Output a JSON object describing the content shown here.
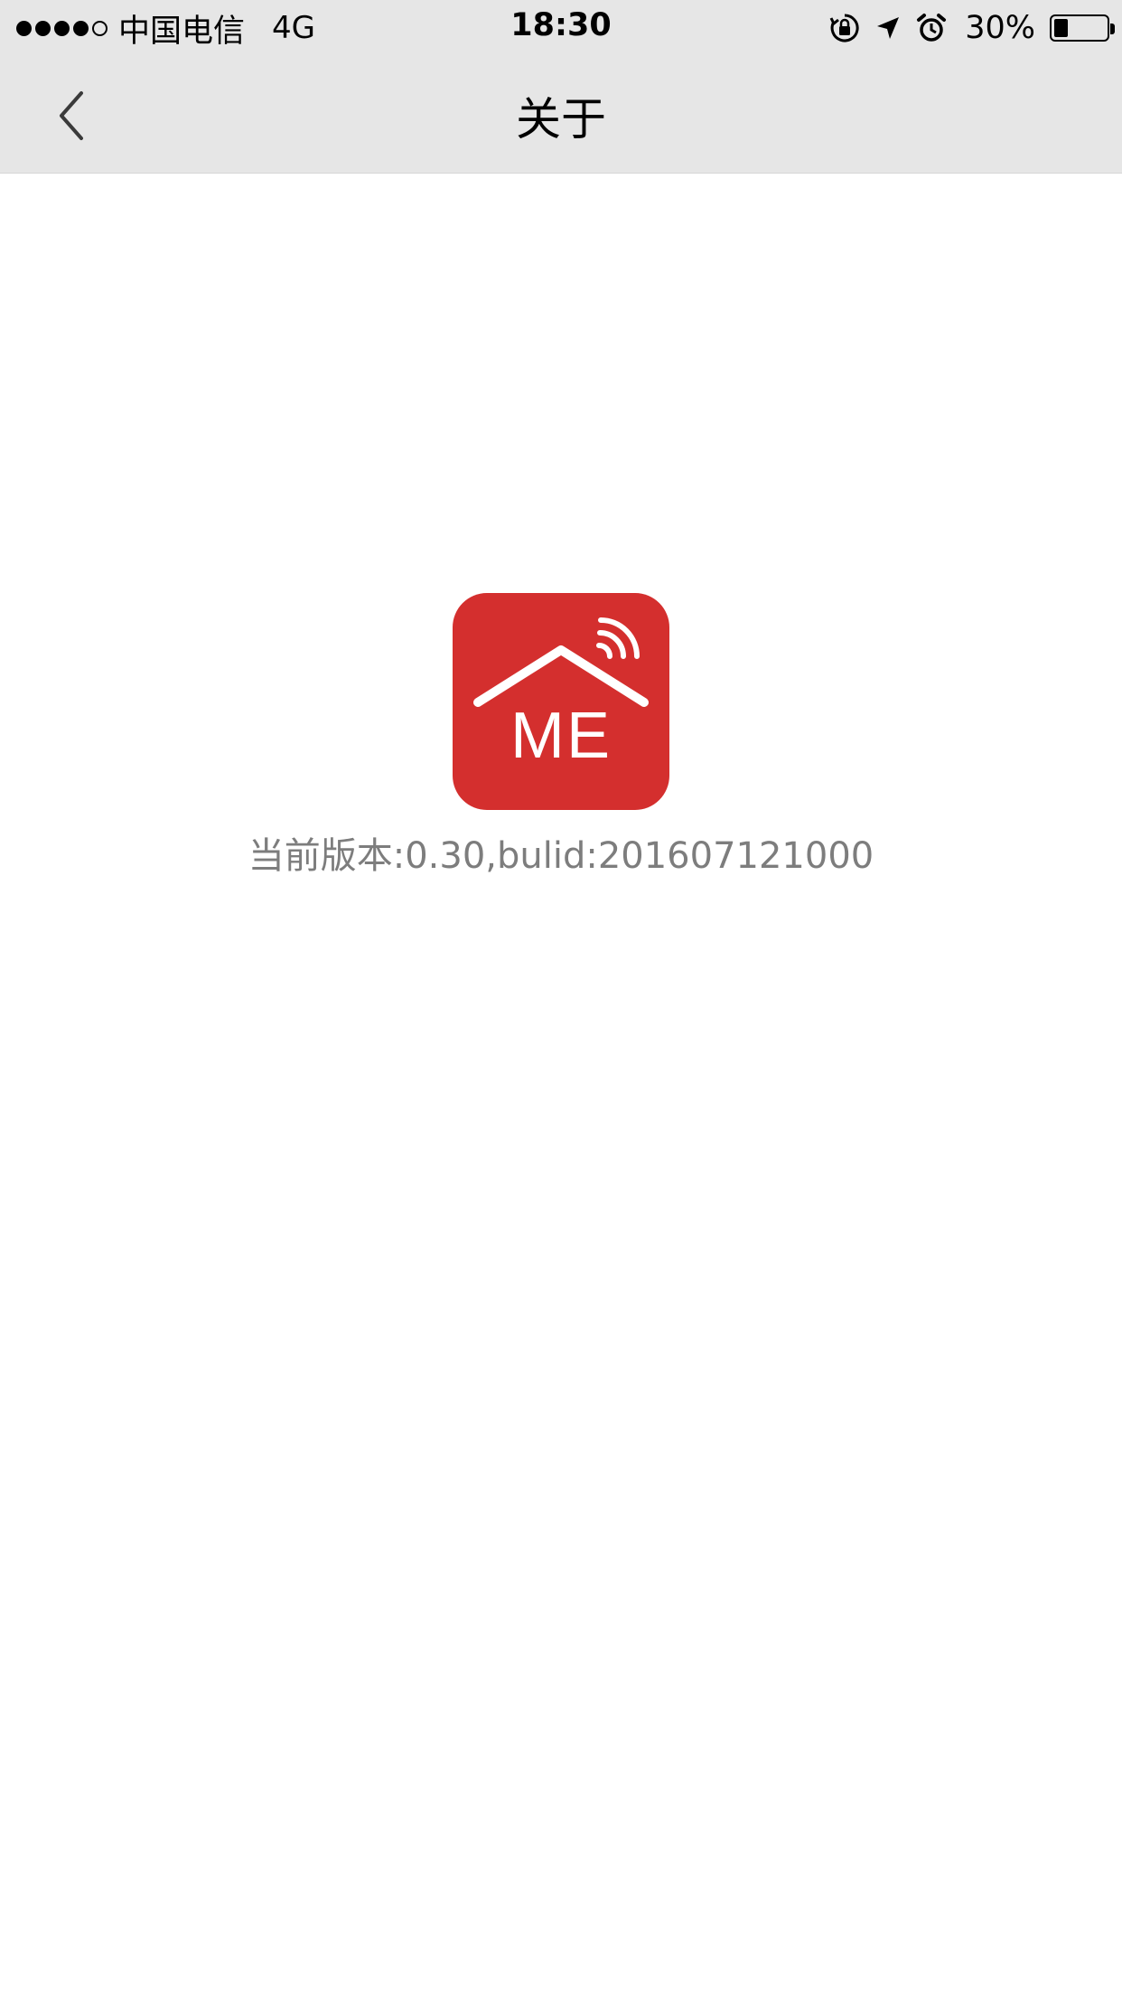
{
  "status_bar": {
    "carrier": "中国电信",
    "network": "4G",
    "time": "18:30",
    "battery_percent": "30%",
    "battery_level": 0.3
  },
  "nav": {
    "title": "关于",
    "back_icon": "chevron-left-icon"
  },
  "about": {
    "logo_text": "ME",
    "logo_color": "#d42f2e",
    "version_text": "当前版本:0.30,bulid:201607121000"
  }
}
